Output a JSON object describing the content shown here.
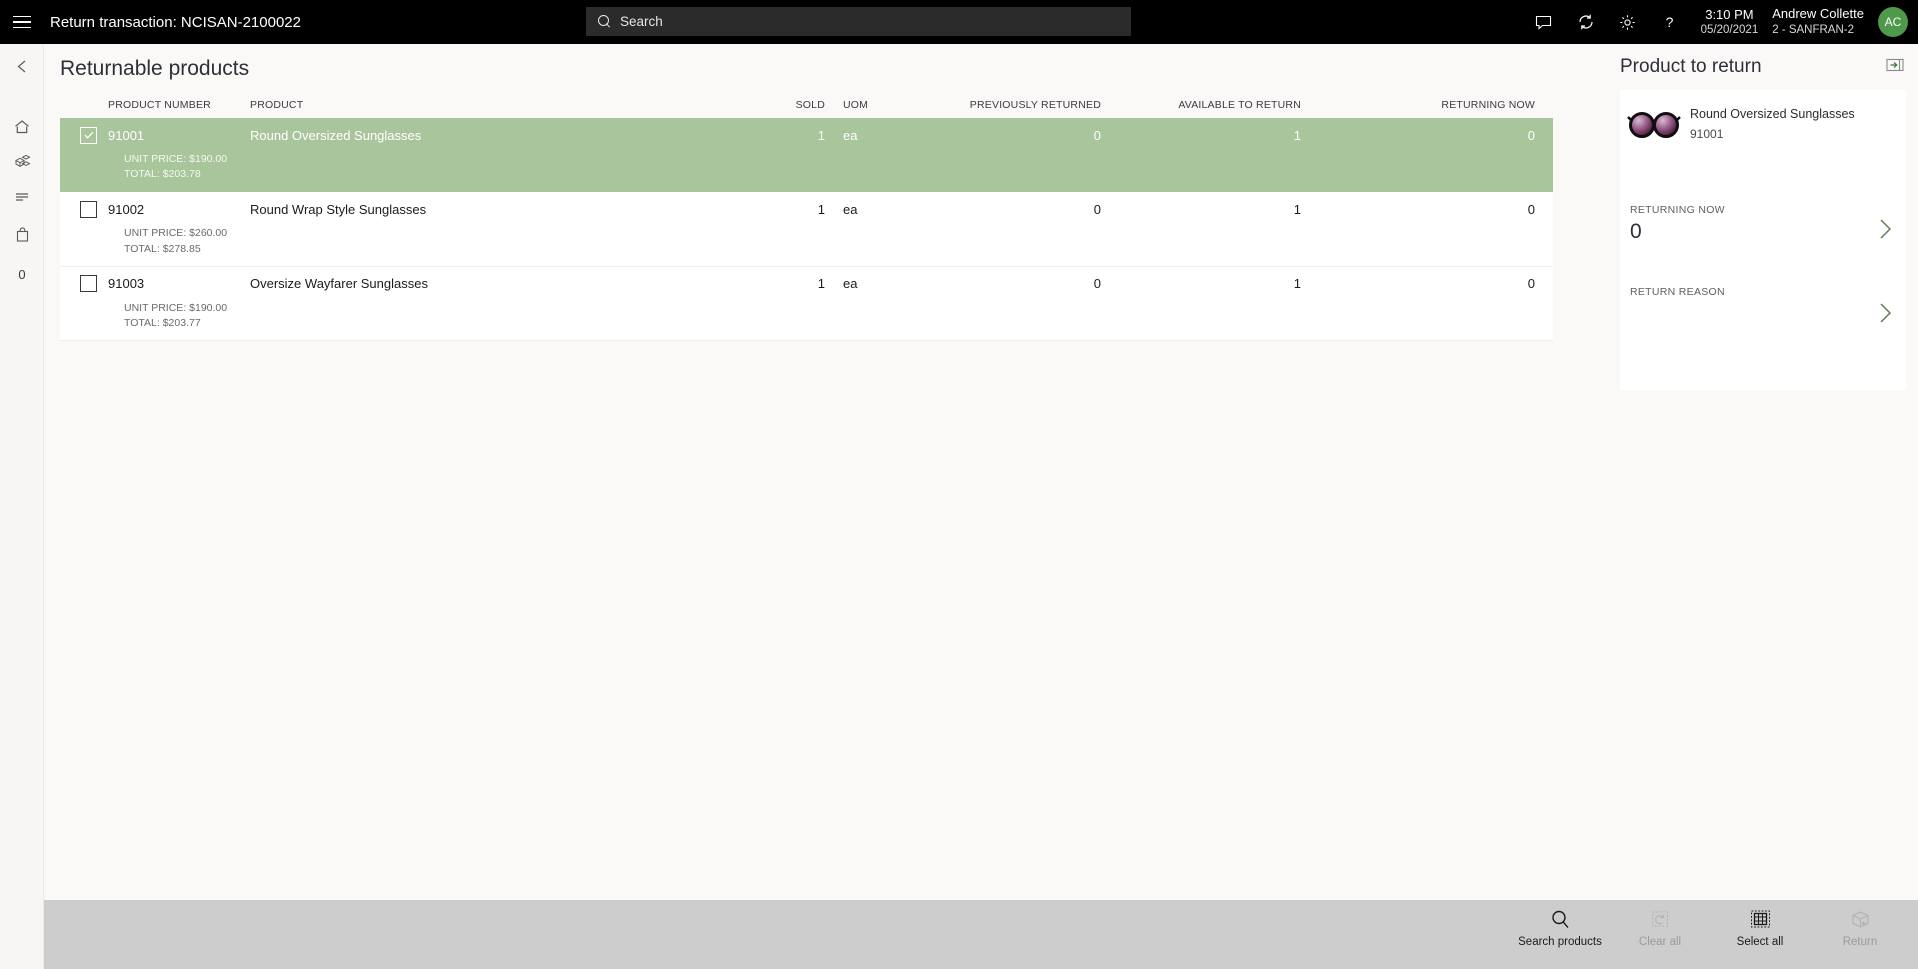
{
  "topbar": {
    "menu_icon": "hamburger-icon",
    "title": "Return transaction: NCISAN-2100022",
    "search": {
      "placeholder": "Search",
      "icon": "search-icon"
    },
    "icons": [
      "message-icon",
      "sync-icon",
      "settings-gear-icon",
      "help-question-icon"
    ],
    "time": "3:10 PM",
    "date": "05/20/2021",
    "user_name": "Andrew Collette",
    "user_store": "2 - SANFRAN-2",
    "avatar_initials": "AC",
    "avatar_color": "#4f9a4a"
  },
  "rail": {
    "items": [
      {
        "icon": "back-arrow-icon",
        "name": "back"
      },
      {
        "icon": "home-icon",
        "name": "home"
      },
      {
        "icon": "products-cube-icon",
        "name": "products"
      },
      {
        "icon": "list-lines-icon",
        "name": "list"
      },
      {
        "icon": "shopping-bag-icon",
        "name": "cart"
      }
    ],
    "count": "0"
  },
  "main": {
    "page_title": "Returnable products",
    "columns": {
      "product_number": "PRODUCT NUMBER",
      "product": "PRODUCT",
      "sold": "SOLD",
      "uom": "UOM",
      "previously_returned": "PREVIOUSLY RETURNED",
      "available_to_return": "AVAILABLE TO RETURN",
      "returning_now": "RETURNING NOW"
    },
    "rows": [
      {
        "selected": true,
        "checked": true,
        "product_number": "91001",
        "product": "Round Oversized Sunglasses",
        "sold": "1",
        "uom": "ea",
        "previously_returned": "0",
        "available_to_return": "1",
        "returning_now": "0",
        "unit_price": "UNIT PRICE: $190.00",
        "total": "TOTAL: $203.78"
      },
      {
        "selected": false,
        "checked": false,
        "product_number": "91002",
        "product": "Round Wrap Style Sunglasses",
        "sold": "1",
        "uom": "ea",
        "previously_returned": "0",
        "available_to_return": "1",
        "returning_now": "0",
        "unit_price": "UNIT PRICE: $260.00",
        "total": "TOTAL: $278.85"
      },
      {
        "selected": false,
        "checked": false,
        "product_number": "91003",
        "product": "Oversize Wayfarer Sunglasses",
        "sold": "1",
        "uom": "ea",
        "previously_returned": "0",
        "available_to_return": "1",
        "returning_now": "0",
        "unit_price": "UNIT PRICE: $190.00",
        "total": "TOTAL: $203.77"
      }
    ],
    "selected_row_color": "#a9c59b"
  },
  "right_panel": {
    "title": "Product to return",
    "dock_icon": "dock-panel-icon",
    "product": {
      "name": "Round Oversized Sunglasses",
      "number": "91001",
      "image": "sunglasses-thumbnail"
    },
    "returning_now": {
      "label": "RETURNING NOW",
      "value": "0",
      "chevron": "chevron-right-icon"
    },
    "return_reason": {
      "label": "RETURN REASON",
      "value": "",
      "chevron": "chevron-right-icon"
    }
  },
  "command_bar": {
    "buttons": [
      {
        "label": "Search products",
        "icon": "search-icon",
        "disabled": false
      },
      {
        "label": "Clear all",
        "icon": "clear-all-icon",
        "disabled": true
      },
      {
        "label": "Select all",
        "icon": "select-all-grid-icon",
        "disabled": false
      },
      {
        "label": "Return",
        "icon": "return-box-icon",
        "disabled": true
      }
    ]
  }
}
